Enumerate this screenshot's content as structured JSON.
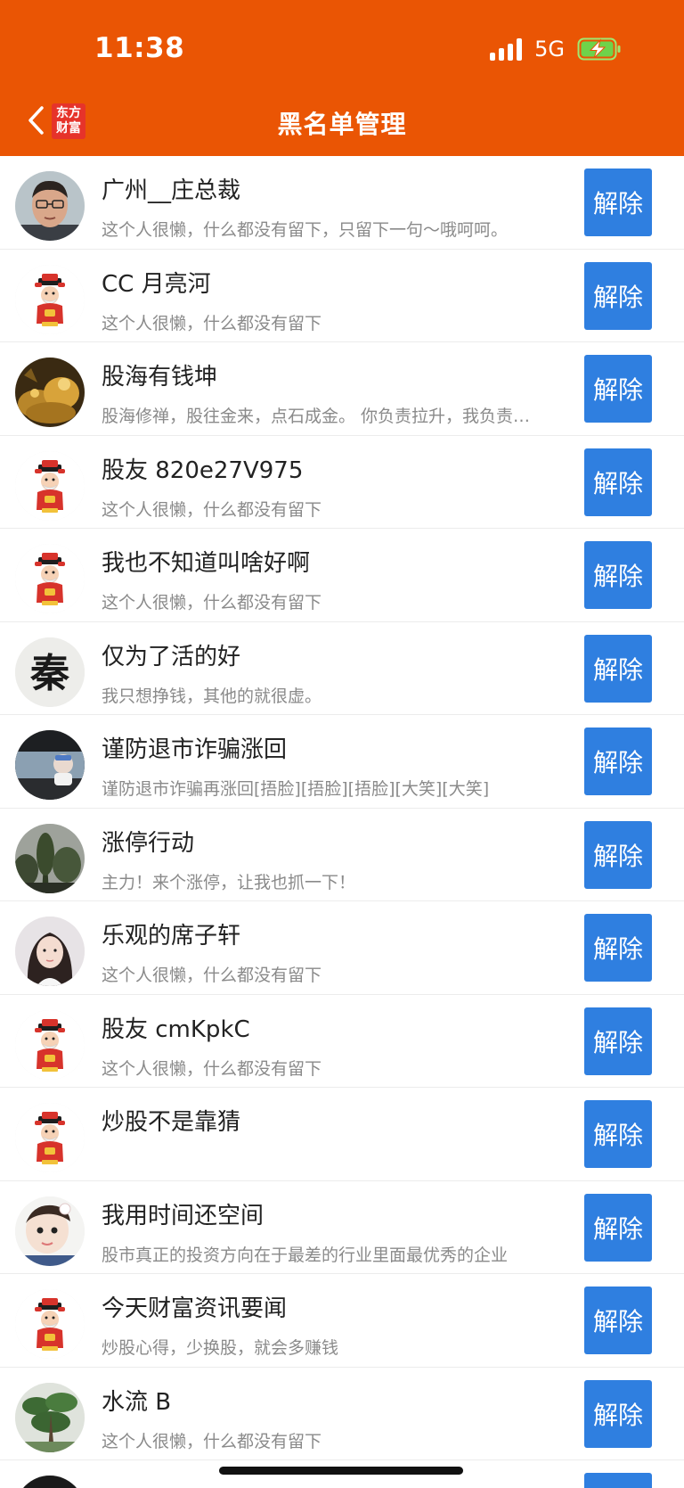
{
  "status_bar": {
    "time": "11:38",
    "network": "5G"
  },
  "nav": {
    "title": "黑名单管理",
    "logo_line1": "东方",
    "logo_line2": "财富"
  },
  "unblock_label": "解除",
  "users": [
    {
      "name": "广州__庄总裁",
      "bio": "这个人很懒，什么都没有留下，只留下一句～哦呵呵。",
      "avatar": "photo-man-glasses"
    },
    {
      "name": "CC 月亮河",
      "bio": "这个人很懒，什么都没有留下",
      "avatar": "default-fortune-god"
    },
    {
      "name": "股海有钱坤",
      "bio": "股海修禅，股往金来，点石成金。 你负责拉升，我负责…",
      "avatar": "photo-gold"
    },
    {
      "name": "股友 820e27V975",
      "bio": "这个人很懒，什么都没有留下",
      "avatar": "default-fortune-god"
    },
    {
      "name": "我也不知道叫啥好啊",
      "bio": "这个人很懒，什么都没有留下",
      "avatar": "default-fortune-god"
    },
    {
      "name": "仅为了活的好",
      "bio": "我只想挣钱，其他的就很虚。",
      "avatar": "calligraphy-qin"
    },
    {
      "name": "谨防退市诈骗涨回",
      "bio": "谨防退市诈骗再涨回[捂脸][捂脸][捂脸][大笑][大笑]",
      "avatar": "photo-car-driver"
    },
    {
      "name": "涨停行动",
      "bio": "主力！来个涨停，让我也抓一下！",
      "avatar": "photo-trees"
    },
    {
      "name": "乐观的席子轩",
      "bio": "这个人很懒，什么都没有留下",
      "avatar": "photo-girl"
    },
    {
      "name": "股友 cmKpkC",
      "bio": "这个人很懒，什么都没有留下",
      "avatar": "default-fortune-god"
    },
    {
      "name": "炒股不是靠猜",
      "bio": "",
      "avatar": "default-fortune-god"
    },
    {
      "name": "我用时间还空间",
      "bio": "股市真正的投资方向在于最差的行业里面最优秀的企业",
      "avatar": "photo-baby"
    },
    {
      "name": "今天财富资讯要闻",
      "bio": "炒股心得，少换股，就会多赚钱",
      "avatar": "default-fortune-god"
    },
    {
      "name": "水流 B",
      "bio": "这个人很懒，什么都没有留下",
      "avatar": "photo-bonsai"
    },
    {
      "name": "",
      "bio": "",
      "avatar": "photo-dark"
    }
  ]
}
